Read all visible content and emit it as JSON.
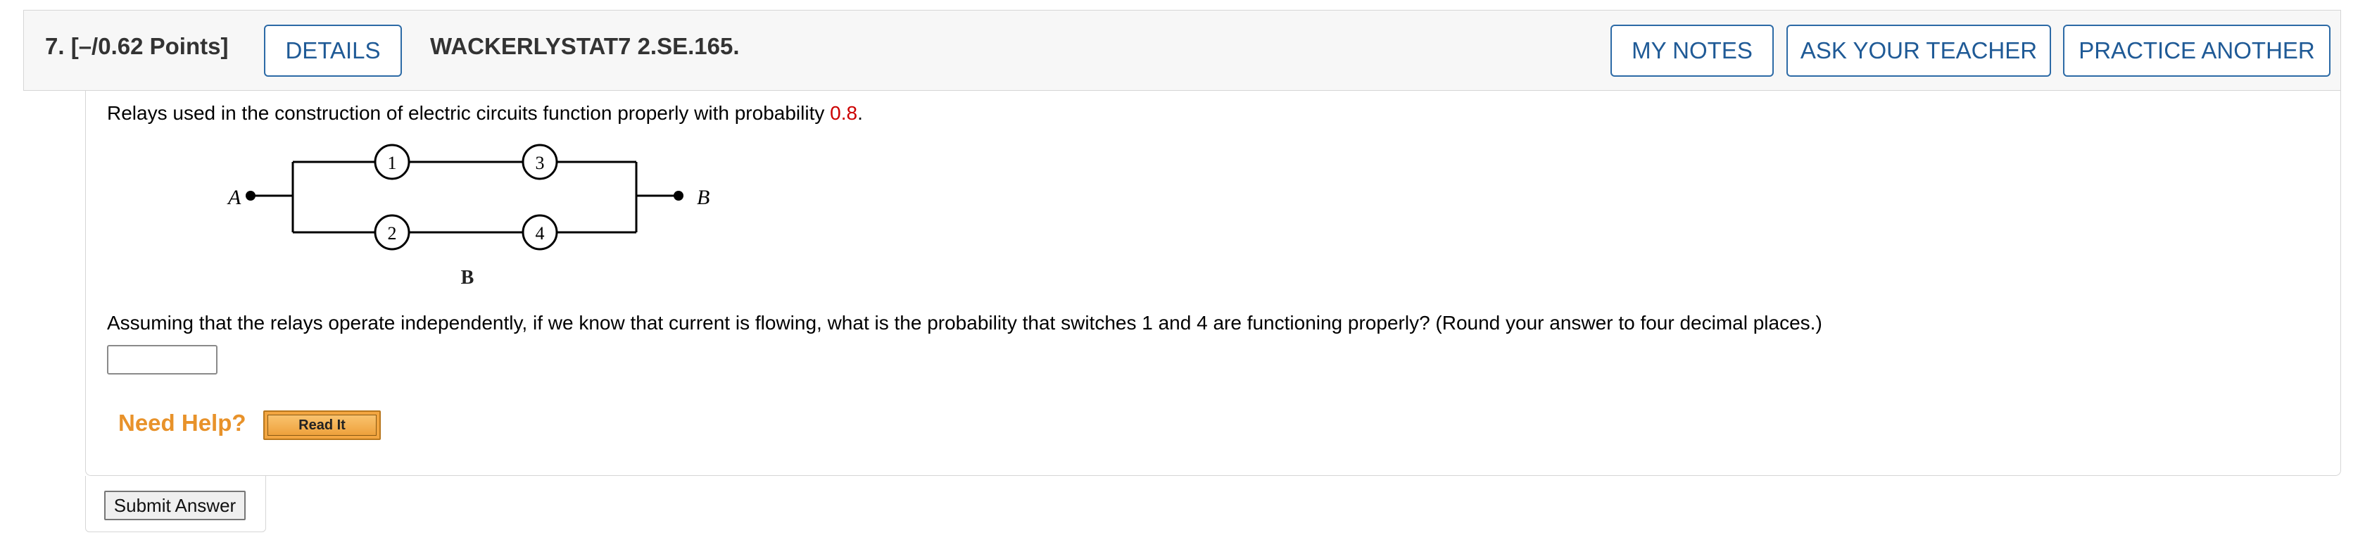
{
  "header": {
    "question_number": "7.",
    "points": "[–/0.62 Points]",
    "details_label": "DETAILS",
    "question_code": "WACKERLYSTAT7 2.SE.165.",
    "my_notes_label": "MY NOTES",
    "ask_teacher_label": "ASK YOUR TEACHER",
    "practice_another_label": "PRACTICE ANOTHER"
  },
  "problem": {
    "prompt_text": "Relays used in the construction of electric circuits function properly with probability ",
    "probability": "0.8",
    "prompt_end": ".",
    "question_text": "Assuming that the relays operate independently, if we know that current is flowing, what is the probability that switches 1 and 4 are functioning properly? (Round your answer to four decimal places.)"
  },
  "diagram": {
    "left_terminal": "A",
    "right_terminal": "B",
    "relay_labels": [
      "1",
      "2",
      "3",
      "4"
    ],
    "caption": "B"
  },
  "answer": {
    "value": ""
  },
  "help": {
    "need_help_label": "Need Help?",
    "read_it_label": "Read It"
  },
  "actions": {
    "submit_label": "Submit Answer"
  },
  "colors": {
    "button_border": "#2c6aa6",
    "probability_red": "#cc0000",
    "need_help_orange": "#e8922a",
    "read_it_fill": "#f3a641"
  }
}
